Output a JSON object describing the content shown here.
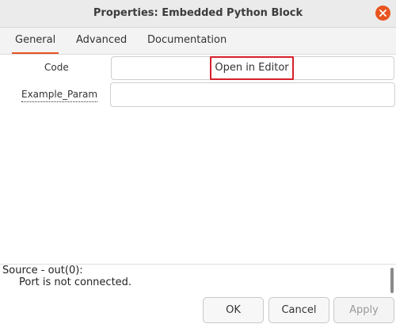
{
  "window": {
    "title": "Properties: Embedded Python Block"
  },
  "tabs": [
    {
      "label": "General",
      "active": true
    },
    {
      "label": "Advanced",
      "active": false
    },
    {
      "label": "Documentation",
      "active": false
    }
  ],
  "form": {
    "code_label": "Code",
    "open_editor_label": "Open in Editor",
    "param_label": "Example_Param",
    "param_value": ""
  },
  "status": {
    "title": "Source - out(0):",
    "message": "Port is not connected."
  },
  "buttons": {
    "ok": "OK",
    "cancel": "Cancel",
    "apply": "Apply"
  },
  "colors": {
    "accent": "#e95420",
    "highlight_border": "#d6202c"
  },
  "icons": {
    "close": "close-icon"
  }
}
